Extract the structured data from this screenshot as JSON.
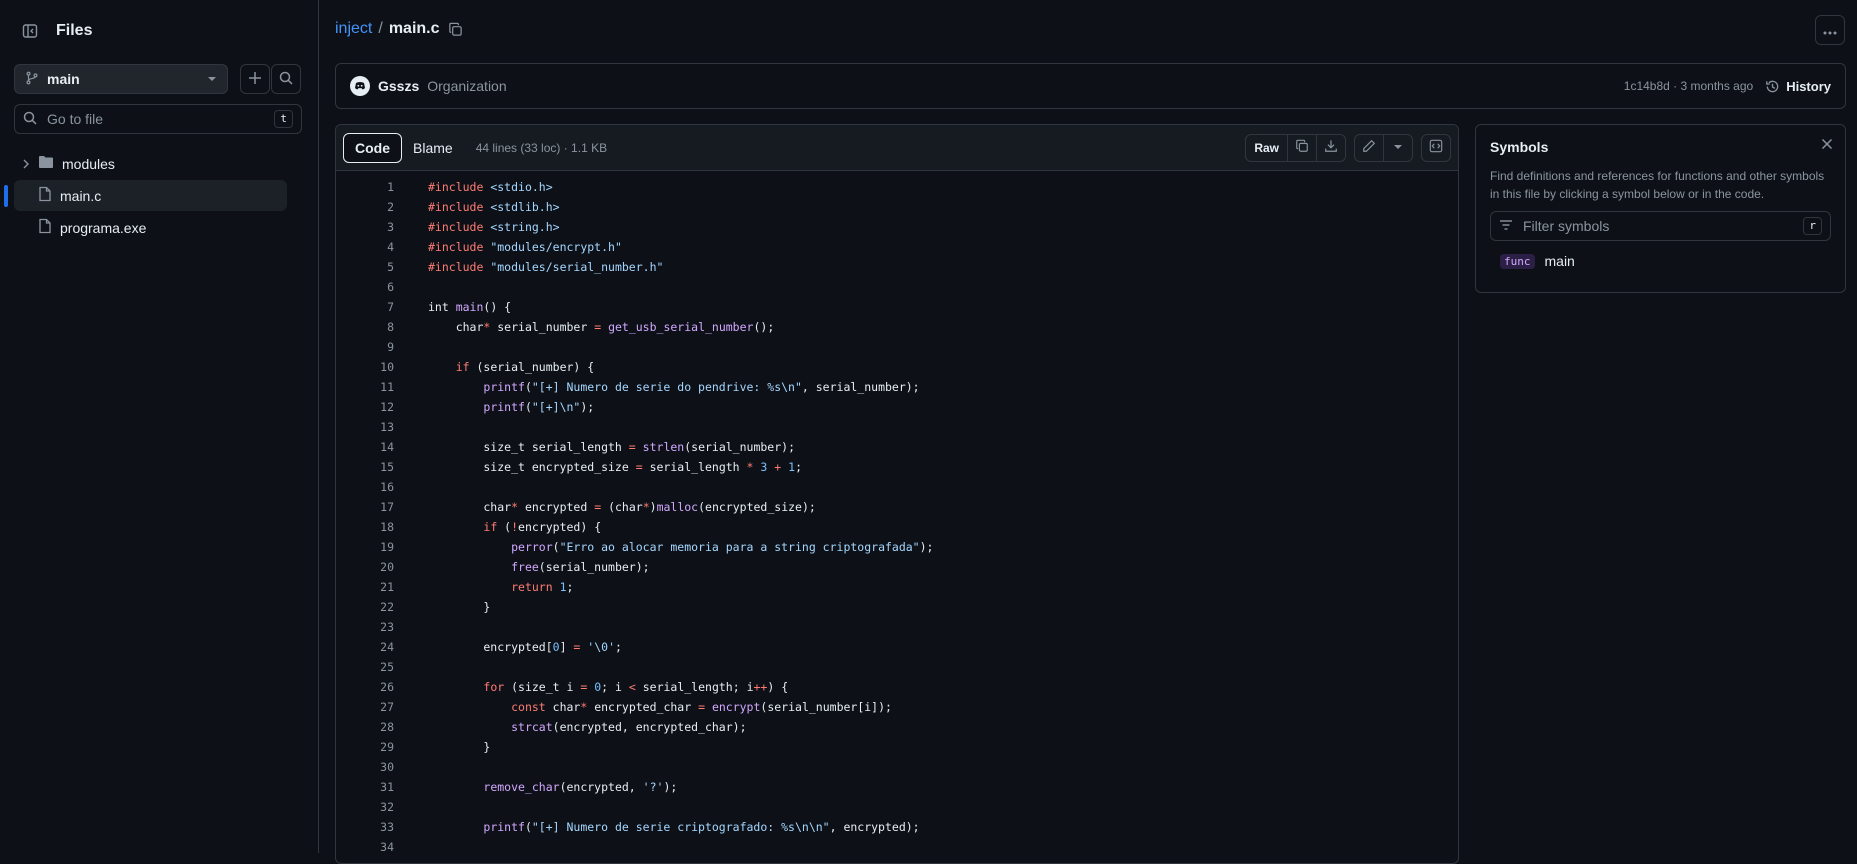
{
  "sidebar": {
    "title": "Files",
    "branch": "main",
    "goto_placeholder": "Go to file",
    "goto_shortcut": "t",
    "tree": [
      {
        "name": "modules",
        "type": "folder"
      },
      {
        "name": "main.c",
        "type": "file",
        "selected": true
      },
      {
        "name": "programa.exe",
        "type": "file"
      }
    ]
  },
  "breadcrumb": {
    "repo": "inject",
    "separator": "/",
    "file": "main.c"
  },
  "commit": {
    "author": "Gsszs",
    "role": "Organization",
    "sha_time": "1c14b8d · 3 months ago",
    "history_label": "History"
  },
  "code_header": {
    "tab_code": "Code",
    "tab_blame": "Blame",
    "meta": "44 lines (33 loc) · 1.1 KB",
    "raw_label": "Raw"
  },
  "code_lines": [
    {
      "n": "1",
      "html": "<span class='k'>#include</span> <span class='s'>&lt;stdio.h&gt;</span>"
    },
    {
      "n": "2",
      "html": "<span class='k'>#include</span> <span class='s'>&lt;stdlib.h&gt;</span>"
    },
    {
      "n": "3",
      "html": "<span class='k'>#include</span> <span class='s'>&lt;string.h&gt;</span>"
    },
    {
      "n": "4",
      "html": "<span class='k'>#include</span> <span class='s'>\"modules/encrypt.h\"</span>"
    },
    {
      "n": "5",
      "html": "<span class='k'>#include</span> <span class='s'>\"modules/serial_number.h\"</span>"
    },
    {
      "n": "6",
      "html": ""
    },
    {
      "n": "7",
      "html": "int <span class='f'>main</span>() {"
    },
    {
      "n": "8",
      "html": "    char<span class='k'>*</span> serial_number <span class='k'>=</span> <span class='f'>get_usb_serial_number</span>();"
    },
    {
      "n": "9",
      "html": ""
    },
    {
      "n": "10",
      "html": "    <span class='k'>if</span> (serial_number) {"
    },
    {
      "n": "11",
      "html": "        <span class='f'>printf</span>(<span class='s'>\"[+] Numero de serie do pendrive: %s\\n\"</span>, serial_number);"
    },
    {
      "n": "12",
      "html": "        <span class='f'>printf</span>(<span class='s'>\"[+]\\n\"</span>);"
    },
    {
      "n": "13",
      "html": ""
    },
    {
      "n": "14",
      "html": "        size_t serial_length <span class='k'>=</span> <span class='f'>strlen</span>(serial_number);"
    },
    {
      "n": "15",
      "html": "        size_t encrypted_size <span class='k'>=</span> serial_length <span class='k'>*</span> <span class='n'>3</span> <span class='k'>+</span> <span class='n'>1</span>;"
    },
    {
      "n": "16",
      "html": ""
    },
    {
      "n": "17",
      "html": "        char<span class='k'>*</span> encrypted <span class='k'>=</span> (char<span class='k'>*</span>)<span class='f'>malloc</span>(encrypted_size);"
    },
    {
      "n": "18",
      "html": "        <span class='k'>if</span> (<span class='k'>!</span>encrypted) {"
    },
    {
      "n": "19",
      "html": "            <span class='f'>perror</span>(<span class='s'>\"Erro ao alocar memoria para a string criptografada\"</span>);"
    },
    {
      "n": "20",
      "html": "            <span class='f'>free</span>(serial_number);"
    },
    {
      "n": "21",
      "html": "            <span class='k'>return</span> <span class='n'>1</span>;"
    },
    {
      "n": "22",
      "html": "        }"
    },
    {
      "n": "23",
      "html": ""
    },
    {
      "n": "24",
      "html": "        encrypted[<span class='n'>0</span>] <span class='k'>=</span> <span class='s'>'\\0'</span>;"
    },
    {
      "n": "25",
      "html": ""
    },
    {
      "n": "26",
      "html": "        <span class='k'>for</span> (size_t i <span class='k'>=</span> <span class='n'>0</span>; i <span class='k'>&lt;</span> serial_length; i<span class='k'>++</span>) {"
    },
    {
      "n": "27",
      "html": "            <span class='k'>const</span> char<span class='k'>*</span> encrypted_char <span class='k'>=</span> <span class='f'>encrypt</span>(serial_number[i]);"
    },
    {
      "n": "28",
      "html": "            <span class='f'>strcat</span>(encrypted, encrypted_char);"
    },
    {
      "n": "29",
      "html": "        }"
    },
    {
      "n": "30",
      "html": ""
    },
    {
      "n": "31",
      "html": "        <span class='f'>remove_char</span>(encrypted, <span class='s'>'?'</span>);"
    },
    {
      "n": "32",
      "html": ""
    },
    {
      "n": "33",
      "html": "        <span class='f'>printf</span>(<span class='s'>\"[+] Numero de serie criptografado: %s\\n\\n\"</span>, encrypted);"
    },
    {
      "n": "34",
      "html": ""
    }
  ],
  "symbols": {
    "title": "Symbols",
    "description": "Find definitions and references for functions and other symbols in this file by clicking a symbol below or in the code.",
    "filter_placeholder": "Filter symbols",
    "filter_shortcut": "r",
    "items": [
      {
        "kind": "func",
        "name": "main"
      }
    ]
  },
  "colors": {
    "accent": "#4493f8",
    "background": "#0d1117",
    "border": "#30363d"
  }
}
